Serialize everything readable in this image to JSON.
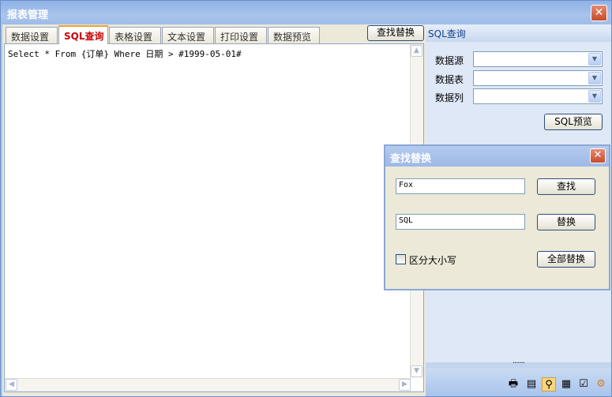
{
  "window": {
    "title": "报表管理"
  },
  "tabs": [
    {
      "label": "数据设置"
    },
    {
      "label": "SQL查询"
    },
    {
      "label": "表格设置"
    },
    {
      "label": "文本设置"
    },
    {
      "label": "打印设置"
    },
    {
      "label": "数据预览"
    }
  ],
  "toolbar": {
    "find_replace_label": "查找替换"
  },
  "editor": {
    "content": "Select * From {订单} Where 日期 > #1999-05-01#"
  },
  "sql_panel": {
    "header": "SQL查询",
    "fields": [
      {
        "label": "数据源",
        "value": ""
      },
      {
        "label": "数据表",
        "value": ""
      },
      {
        "label": "数据列",
        "value": ""
      }
    ],
    "preview_button": "SQL预览"
  },
  "find_dialog": {
    "title": "查找替换",
    "find_value": "Fox",
    "replace_value": "SQL",
    "find_button": "查找",
    "replace_button": "替换",
    "replace_all_button": "全部替换",
    "case_sensitive_label": "区分大小写",
    "case_sensitive_checked": false
  },
  "bottom_toolbar": {
    "icons": [
      "print-icon",
      "document-icon",
      "search-icon",
      "table-icon",
      "checklist-icon",
      "gear-icon"
    ],
    "active_icon": "search-icon"
  },
  "colors": {
    "accent": "#f0a030",
    "active_tab_text": "#cc0000",
    "title_bar": "#a9c4ec"
  }
}
